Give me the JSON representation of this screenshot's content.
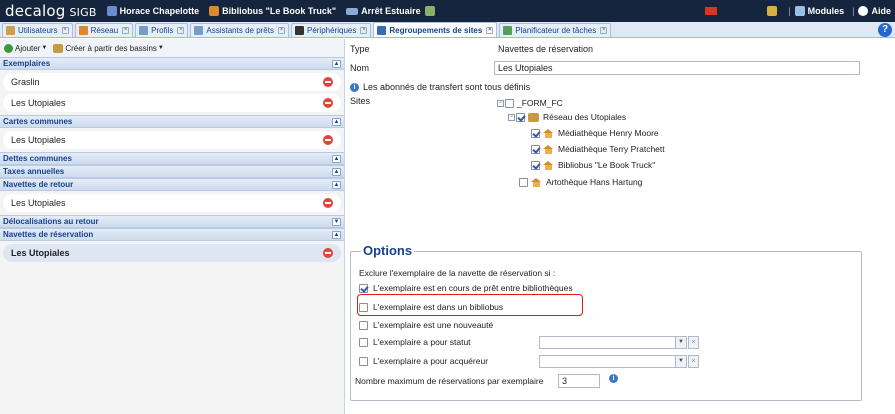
{
  "topbar": {
    "logo": "decalog",
    "logo_sub": "SIGB",
    "user": "Horace Chapelotte",
    "library": "Bibliobus \"Le Book Truck\"",
    "stop": "Arrêt Estuaire",
    "modules": "Modules",
    "help": "Aide",
    "sep": "|"
  },
  "tabs": [
    {
      "label": "Utilisateurs",
      "icon": "users-icon",
      "color": "#c8a050"
    },
    {
      "label": "Réseau",
      "icon": "network-icon",
      "color": "#d98a2a"
    },
    {
      "label": "Profils",
      "icon": "profiles-icon",
      "color": "#7a9ac8"
    },
    {
      "label": "Assistants de prêts",
      "icon": "loan-assistant-icon",
      "color": "#7a9ac8"
    },
    {
      "label": "Périphériques",
      "icon": "devices-icon",
      "color": "#333333"
    },
    {
      "label": "Regroupements de sites",
      "icon": "site-groups-icon",
      "color": "#3a6ab0"
    },
    {
      "label": "Planificateur de tâches",
      "icon": "task-scheduler-icon",
      "color": "#5a9a5a"
    }
  ],
  "tab_close_glyph": "×",
  "left": {
    "add_label": "Ajouter",
    "create_label": "Créer à partir des bassins",
    "sections": [
      {
        "title": "Exemplaires",
        "toggle": "▲",
        "items": [
          "Graslin",
          "Les Utopiales"
        ]
      },
      {
        "title": "Cartes communes",
        "toggle": "▲",
        "items": [
          "Les Utopiales"
        ]
      },
      {
        "title": "Dettes communes",
        "toggle": "▲",
        "items": []
      },
      {
        "title": "Taxes annuelles",
        "toggle": "▲",
        "items": []
      },
      {
        "title": "Navettes de retour",
        "toggle": "▲",
        "items": [
          "Les Utopiales"
        ]
      },
      {
        "title": "Délocalisations au retour",
        "toggle": "▼",
        "items": []
      },
      {
        "title": "Navettes de réservation",
        "toggle": "▲",
        "items": [
          "Les Utopiales"
        ]
      }
    ]
  },
  "form": {
    "type_label": "Type",
    "type_value": "Navettes de réservation",
    "name_label": "Nom",
    "name_value": "Les Utopiales",
    "info_text": "Les abonnés de transfert sont tous définis",
    "sites_label": "Sites",
    "tree": {
      "root": "_FORM_FC",
      "network": "Réseau des Utopiales",
      "children": [
        "Médiathèque Henry Moore",
        "Médiathèque Terry Pratchett",
        "Bibliobus \"Le Book Truck\""
      ],
      "other": "Artothèque Hans Hartung",
      "expander": "−"
    }
  },
  "options": {
    "legend": "Options",
    "exclude_label": "Exclure l'exemplaire de la navette de réservation si :",
    "checks": [
      {
        "label": "L'exemplaire est en cours de prêt entre bibliothèques",
        "checked": true
      },
      {
        "label": "L'exemplaire est dans un bibliobus",
        "checked": false
      },
      {
        "label": "L'exemplaire est une nouveauté",
        "checked": false
      },
      {
        "label": "L'exemplaire a pour statut",
        "checked": false
      },
      {
        "label": "L'exemplaire a pour acquéreur",
        "checked": false
      }
    ],
    "max_label": "Nombre maximum de réservations par exemplaire",
    "max_value": "3",
    "highlight_color": "#d81e1e"
  }
}
